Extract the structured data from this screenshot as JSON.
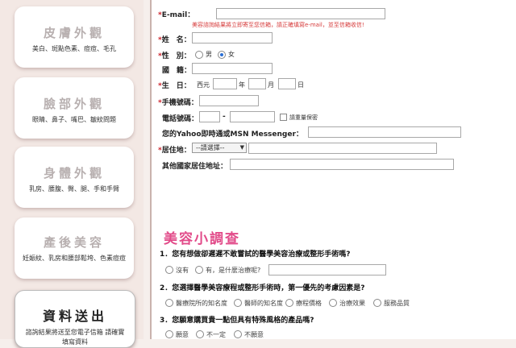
{
  "sidebar": {
    "cards": [
      {
        "title": "皮膚外觀",
        "desc": "美白、斑點色素、痘痘、毛孔"
      },
      {
        "title": "臉部外觀",
        "desc": "眼睛、鼻子、嘴巴、皺紋問題"
      },
      {
        "title": "身體外觀",
        "desc": "乳房、腰腹、臀、腿、手和手臂"
      },
      {
        "title": "產後美容",
        "desc": "妊娠紋、乳房和腰部鬆垮、色素痘痘"
      },
      {
        "title": "資料送出",
        "desc": "諮詢結果將送至您電子信箱 請確實填寫資料"
      }
    ]
  },
  "form": {
    "email_label": "E-mail：",
    "email_note": "美容諮詢結果將立即寄至您信箱，請正確填寫e-mail，並至信箱收信!",
    "name_label": "姓　名：",
    "gender_label": "性　別：",
    "gender_male": "男",
    "gender_female": "女",
    "nationality_label": "國　籍：",
    "birth_label": "生　日：",
    "birth_era": "西元",
    "birth_year": "年",
    "birth_month": "月",
    "birth_day": "日",
    "mobile_label": "手機號碼：",
    "phone_label": "電話號碼：",
    "phone_dash": "-",
    "phone_private": "請重量保密",
    "im_label": "您的Yahoo即時通或MSN Messenger：",
    "residence_label": "居住地：",
    "residence_select": "--請選擇--",
    "other_addr_label": "其他國家居住地址："
  },
  "survey": {
    "title": "美容小調查",
    "q1": {
      "label": "1．您有想做卻遲遲不敢嘗試的醫學美容治療或整形手術嗎?",
      "options": [
        "沒有",
        "有，是什麼治療呢?"
      ]
    },
    "q2": {
      "label": "2．您選擇醫學美容療程或整形手術時，第一優先的考慮因素是?",
      "options": [
        "醫療院所的知名度",
        "醫師的知名度",
        "療程價格",
        "治療效果",
        "服務品質"
      ]
    },
    "q3": {
      "label": "3．您願意購買貴一點但具有特殊風格的產品嗎?",
      "options": [
        "願意",
        "不一定",
        "不願意"
      ]
    }
  },
  "colors": {
    "required": "#cc1f28",
    "survey_title": "#e24c8a",
    "note": "#d63a3a"
  }
}
